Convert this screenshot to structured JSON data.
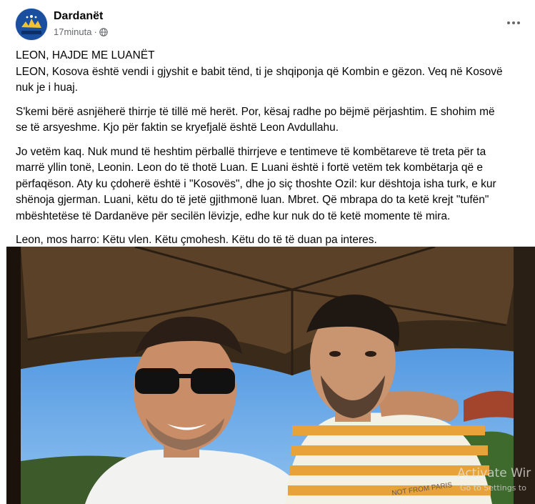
{
  "post": {
    "page_name": "Dardanët",
    "timestamp": "17minuta",
    "separator": "·",
    "privacy_icon": "globe-icon",
    "more_icon": "more-options-icon",
    "paragraphs": [
      [
        "LEON, HAJDE ME LUANËT",
        "LEON, Kosova është vendi i gjyshit e babit tënd, ti je shqiponja që Kombin e gëzon. Veq në Kosovë",
        "nuk je i huaj."
      ],
      [
        "S'kemi bërë asnjëherë thirrje të tillë më herët. Por, kësaj radhe po bëjmë përjashtim. E shohim më",
        "se të arsyeshme. Kjo për faktin se kryefjalë është Leon Avdullahu."
      ],
      [
        "Jo vetëm kaq. Nuk mund të heshtim përballë thirrjeve e tentimeve të kombëtareve të treta për ta",
        "marrë yllin tonë, Leonin. Leon do të thotë Luan. E Luani është i fortë vetëm tek kombëtarja që e",
        "përfaqëson. Aty ku çdoherë është i \"Kosovës\", dhe jo siç thoshte Ozil: kur dështoja isha turk, e kur",
        "shënoja gjerman. Luani, këtu do të jetë gjithmonë luan. Mbret. Që mbrapa do ta ketë krejt \"tufën\"",
        "mbështetëse të Dardanëve për secilën lëvizje, edhe kur nuk do të ketë momente të mira."
      ],
      [
        "Leon, mos harro: Këtu vlen. Këtu çmohesh. Këtu do të të duan pa interes."
      ]
    ],
    "photo": {
      "shirt_print": "NOT FROM PARIS"
    }
  },
  "overlay": {
    "watermark": "Activate Wir",
    "watermark_sub": "Go to Settings to"
  },
  "colors": {
    "text": "#050505",
    "secondary": "#65676b",
    "brand": "#1a4fa0"
  }
}
